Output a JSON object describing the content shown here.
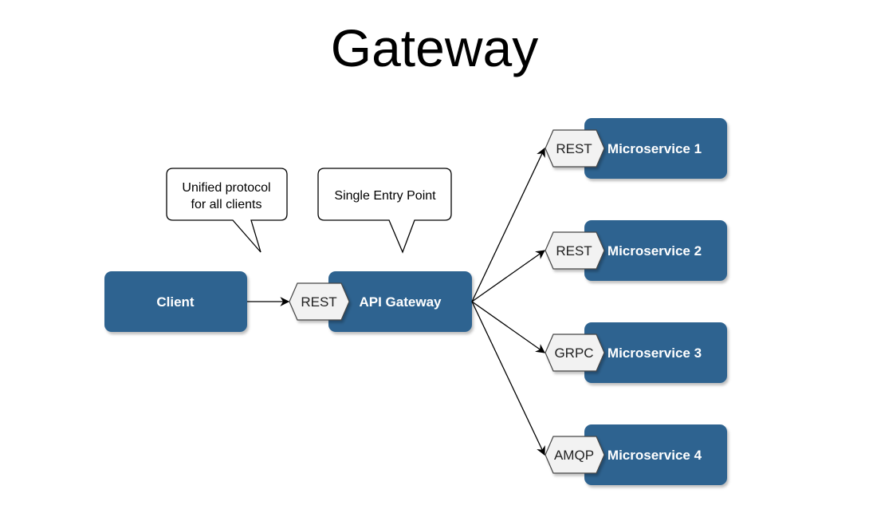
{
  "title": "Gateway",
  "callouts": [
    {
      "lines": [
        "Unified protocol",
        "for all clients"
      ]
    },
    {
      "lines": [
        "Single Entry Point"
      ]
    }
  ],
  "client": {
    "label": "Client"
  },
  "gateway": {
    "label": "API Gateway",
    "protocol": "REST"
  },
  "services": [
    {
      "label": "Microservice 1",
      "protocol": "REST"
    },
    {
      "label": "Microservice 2",
      "protocol": "REST"
    },
    {
      "label": "Microservice 3",
      "protocol": "GRPC"
    },
    {
      "label": "Microservice 4",
      "protocol": "AMQP"
    }
  ],
  "colors": {
    "box": "#2e6490",
    "port": "#f2f2f2"
  }
}
